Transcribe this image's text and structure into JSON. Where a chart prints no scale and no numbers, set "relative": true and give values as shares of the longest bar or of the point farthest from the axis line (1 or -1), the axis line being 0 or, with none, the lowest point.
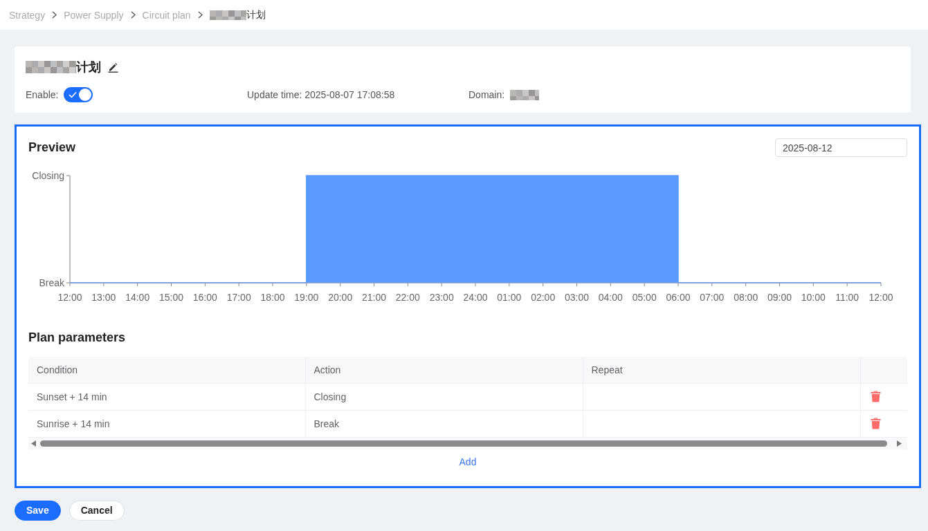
{
  "breadcrumb": [
    {
      "label": "Strategy",
      "current": false,
      "masked": false
    },
    {
      "label": "Power Supply",
      "current": false,
      "masked": false
    },
    {
      "label": "Circuit plan",
      "current": false,
      "masked": false
    },
    {
      "label": "计划",
      "current": true,
      "masked": true
    }
  ],
  "header": {
    "title": "计划",
    "title_masked": true,
    "enable": {
      "label": "Enable:",
      "on": true
    },
    "update_time": "Update time: 2025-08-07 17:08:58",
    "domain": {
      "label": "Domain:",
      "value_masked": true
    }
  },
  "preview": {
    "title": "Preview",
    "date": {
      "value": "2025-08-12"
    },
    "state_labels": [
      "Closing",
      "Break"
    ],
    "chart_data": {
      "type": "area",
      "categories": [
        "12:00",
        "13:00",
        "14:00",
        "15:00",
        "16:00",
        "17:00",
        "18:00",
        "19:00",
        "20:00",
        "21:00",
        "22:00",
        "23:00",
        "24:00",
        "01:00",
        "02:00",
        "03:00",
        "04:00",
        "05:00",
        "06:00",
        "07:00",
        "08:00",
        "09:00",
        "10:00",
        "11:00",
        "12:00"
      ],
      "series": [
        {
          "color": "#5b9aff",
          "values": [
            0,
            0,
            0,
            0,
            0,
            0,
            0,
            1,
            1,
            1,
            1,
            1,
            1,
            1,
            1,
            1,
            1,
            1,
            0,
            0,
            0,
            0,
            0,
            0,
            0
          ]
        }
      ],
      "relative": true
    }
  },
  "plan_parameters": {
    "title": "Plan parameters",
    "table": {
      "columns": [
        "Condition",
        "Action",
        "Repeat"
      ],
      "rows": [
        {
          "condition": "Sunset + 14 min",
          "action": "Closing"
        },
        {
          "condition": "Sunrise + 14 min",
          "action": "Break"
        }
      ]
    },
    "add_link": "Add"
  },
  "buttons": [
    {
      "label": "Save",
      "kind": "primary"
    },
    {
      "label": "Cancel",
      "kind": "secondary"
    }
  ]
}
